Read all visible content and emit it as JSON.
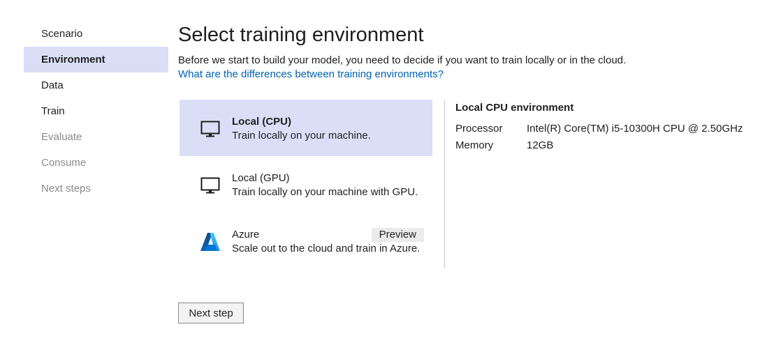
{
  "sidebar": {
    "items": [
      {
        "label": "Scenario",
        "state": "normal"
      },
      {
        "label": "Environment",
        "state": "active"
      },
      {
        "label": "Data",
        "state": "normal"
      },
      {
        "label": "Train",
        "state": "normal"
      },
      {
        "label": "Evaluate",
        "state": "disabled"
      },
      {
        "label": "Consume",
        "state": "disabled"
      },
      {
        "label": "Next steps",
        "state": "disabled"
      }
    ]
  },
  "main": {
    "title": "Select training environment",
    "description": "Before we start to build your model, you need to decide if you want to train locally or in the cloud.",
    "help_link": "What are the differences between training environments?",
    "options": [
      {
        "name": "Local (CPU)",
        "description": "Train locally on your machine.",
        "icon": "monitor-icon",
        "selected": true
      },
      {
        "name": "Local (GPU)",
        "description": "Train locally on your machine with GPU.",
        "icon": "monitor-icon",
        "selected": false
      },
      {
        "name": "Azure",
        "description": "Scale out to the cloud and train in Azure.",
        "icon": "azure-logo-icon",
        "badge": "Preview",
        "selected": false
      }
    ],
    "next_button": "Next step"
  },
  "details": {
    "title": "Local CPU environment",
    "processor_label": "Processor",
    "processor_value": "Intel(R) Core(TM) i5-10300H CPU @ 2.50GHz",
    "memory_label": "Memory",
    "memory_value": "12GB"
  },
  "colors": {
    "selected_background": "#dadff7",
    "link": "#0062b1",
    "disabled_text": "#8a8a8a",
    "badge_background": "#ebebeb",
    "azure_blue": "#0078d4"
  }
}
